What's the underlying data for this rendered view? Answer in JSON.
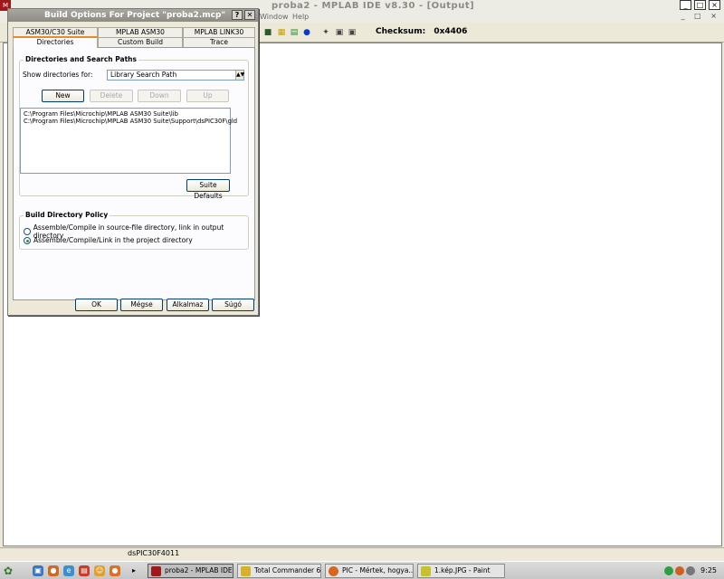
{
  "ide": {
    "title": "proba2 - MPLAB IDE v8.30 - [Output]",
    "menu": [
      "Window",
      "Help"
    ],
    "checksum_label": "Checksum:",
    "checksum_value": "0x4406",
    "device": "dsPIC30F4011"
  },
  "dialog": {
    "title": "Build Options For Project \"proba2.mcp\"",
    "help_btn": "?",
    "close_btn": "✕",
    "tabs_row1": [
      "ASM30/C30 Suite",
      "MPLAB ASM30",
      "MPLAB LINK30"
    ],
    "tabs_row2": [
      "Directories",
      "Custom Build",
      "Trace"
    ],
    "group_dirs": "Directories and Search Paths",
    "show_label": "Show directories for:",
    "show_value": "Library Search Path",
    "btn_new": "New",
    "btn_delete": "Delete",
    "btn_down": "Down",
    "btn_up": "Up",
    "paths": [
      "C:\\Program Files\\Microchip\\MPLAB ASM30 Suite\\lib",
      "C:\\Program Files\\Microchip\\MPLAB ASM30 Suite\\Support\\dsPIC30F\\gld"
    ],
    "btn_suite_defaults": "Suite Defaults",
    "group_policy": "Build Directory Policy",
    "radio1": "Assemble/Compile in source-file directory, link in output directory",
    "radio2": "Assemble/Compile/Link in the project directory",
    "btn_ok": "OK",
    "btn_cancel": "Mégse",
    "btn_apply": "Alkalmaz",
    "btn_help": "Súgó"
  },
  "taskbar": {
    "tasks": [
      "proba2 - MPLAB IDE ...",
      "Total Commander 6....",
      "PIC - Mértek, hogya...",
      "1.kép.JPG - Paint"
    ],
    "clock": "9:25"
  }
}
